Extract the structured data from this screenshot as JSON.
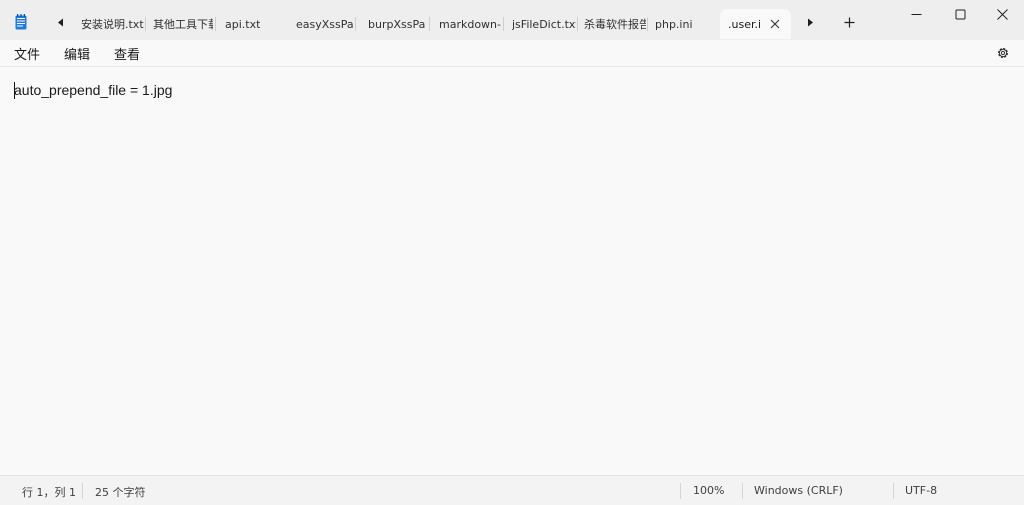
{
  "title_bar": {
    "app_icon": "notepad-icon",
    "scroll_left_icon": "caret-left-icon",
    "scroll_right_icon": "caret-right-icon",
    "new_tab_icon": "plus-icon",
    "tabs": [
      {
        "label": "安装说明.txt"
      },
      {
        "label": "其他工具下载"
      },
      {
        "label": "api.txt"
      },
      {
        "label": "easyXssPaylo"
      },
      {
        "label": "burpXssPaylo"
      },
      {
        "label": "markdown-x"
      },
      {
        "label": "jsFileDict.txt"
      },
      {
        "label": "杀毒软件报告"
      },
      {
        "label": "php.ini"
      },
      {
        "label": ".user.i",
        "active": true
      }
    ],
    "window_controls": {
      "minimize_icon": "minimize-icon",
      "maximize_icon": "maximize-icon",
      "close_icon": "close-icon"
    }
  },
  "menu": {
    "items": [
      {
        "label": "文件"
      },
      {
        "label": "编辑"
      },
      {
        "label": "查看"
      }
    ],
    "settings_icon": "gear-icon"
  },
  "editor": {
    "content": "auto_prepend_file = 1.jpg"
  },
  "status_bar": {
    "position": "行 1，列 1",
    "char_count": "25 个字符",
    "zoom": "100%",
    "line_ending": "Windows (CRLF)",
    "encoding": "UTF-8"
  },
  "colors": {
    "background": "#f3f3f3",
    "editor_background": "#f9f9f9",
    "app_icon_accent": "#1f7ad8"
  }
}
